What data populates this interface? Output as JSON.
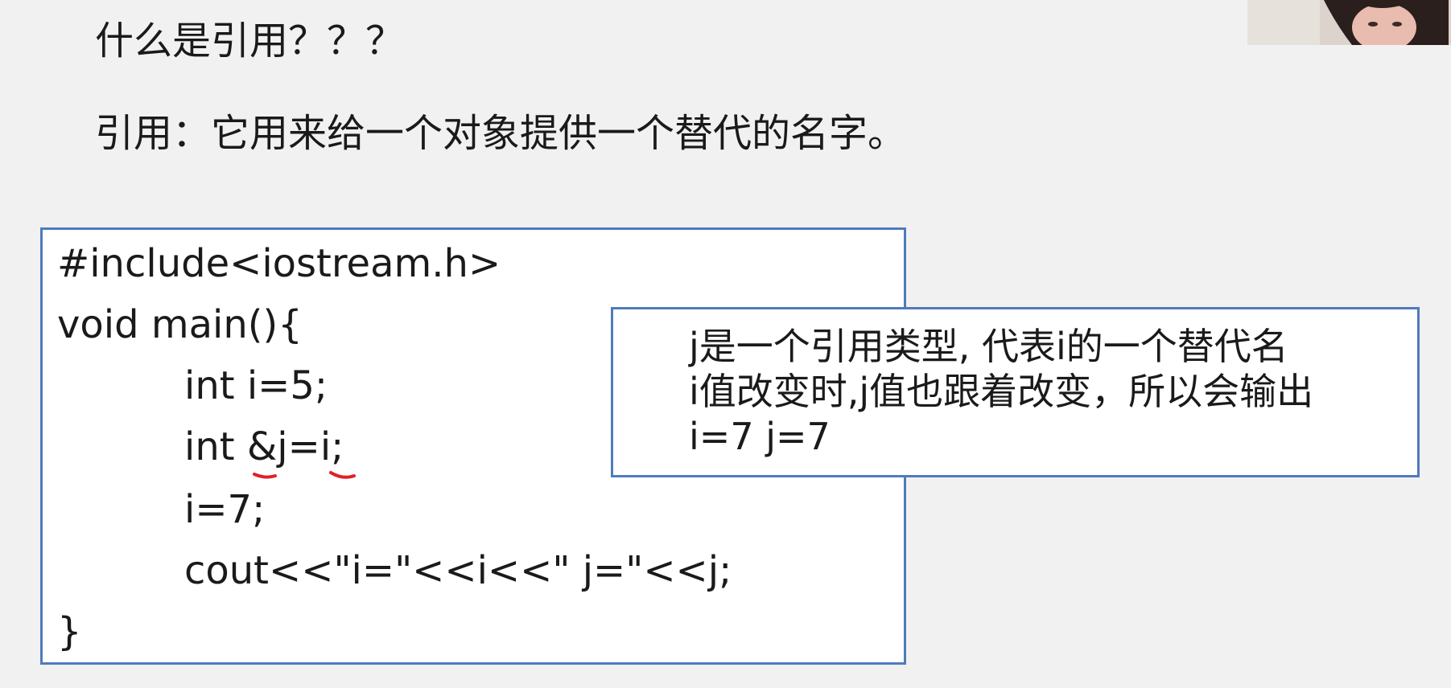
{
  "slide": {
    "question": "什么是引用？？？",
    "definition": "引用：它用来给一个对象提供一个替代的名字。"
  },
  "code": {
    "lines": [
      "#include<iostream.h>",
      "void main(){",
      "int i=5;",
      "int &j=i;",
      "i=7;",
      "cout<<\"i=\"<<i<<\" j=\"<<j;",
      "}"
    ]
  },
  "note": {
    "lines": [
      "j是一个引用类型, 代表i的一个替代名",
      "i值改变时,j值也跟着改变，所以会输出",
      "i=7 j=7"
    ]
  },
  "colors": {
    "background": "#f1f1f1",
    "box_border": "#4f7bbd",
    "pen_mark": "#e0202a"
  }
}
